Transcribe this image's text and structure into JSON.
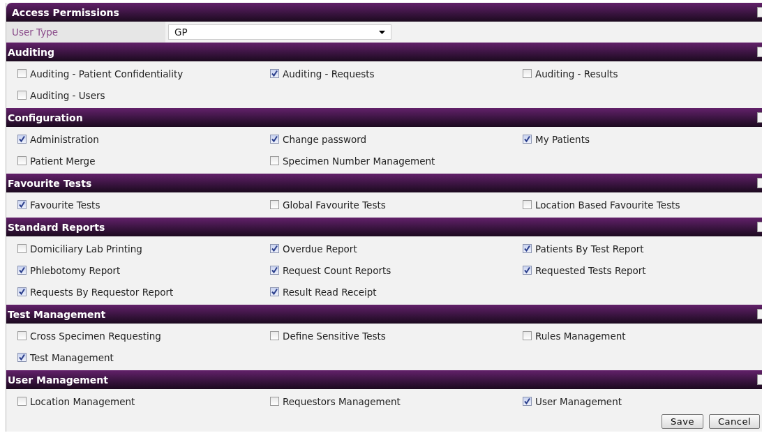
{
  "title": "Access Permissions",
  "title_checked": false,
  "user_type": {
    "label": "User Type",
    "value": "GP"
  },
  "sections": [
    {
      "title": "Auditing",
      "checked": false,
      "items": [
        {
          "label": "Auditing - Patient Confidentiality",
          "checked": false
        },
        {
          "label": "Auditing - Requests",
          "checked": true
        },
        {
          "label": "Auditing - Results",
          "checked": false
        },
        {
          "label": "Auditing - Users",
          "checked": false
        }
      ]
    },
    {
      "title": "Configuration",
      "checked": false,
      "items": [
        {
          "label": "Administration",
          "checked": true
        },
        {
          "label": "Change password",
          "checked": true
        },
        {
          "label": "My Patients",
          "checked": true
        },
        {
          "label": "Patient Merge",
          "checked": false
        },
        {
          "label": "Specimen Number Management",
          "checked": false
        }
      ]
    },
    {
      "title": "Favourite Tests",
      "checked": false,
      "items": [
        {
          "label": "Favourite Tests",
          "checked": true
        },
        {
          "label": "Global Favourite Tests",
          "checked": false
        },
        {
          "label": "Location Based Favourite Tests",
          "checked": false
        }
      ]
    },
    {
      "title": "Standard Reports",
      "checked": false,
      "items": [
        {
          "label": "Domiciliary Lab Printing",
          "checked": false
        },
        {
          "label": "Overdue Report",
          "checked": true
        },
        {
          "label": "Patients By Test Report",
          "checked": true
        },
        {
          "label": "Phlebotomy Report",
          "checked": true
        },
        {
          "label": "Request Count Reports",
          "checked": true
        },
        {
          "label": "Requested Tests Report",
          "checked": true
        },
        {
          "label": "Requests By Requestor Report",
          "checked": true
        },
        {
          "label": "Result Read Receipt",
          "checked": true
        }
      ]
    },
    {
      "title": "Test Management",
      "checked": false,
      "items": [
        {
          "label": "Cross Specimen Requesting",
          "checked": false
        },
        {
          "label": "Define Sensitive Tests",
          "checked": false
        },
        {
          "label": "Rules Management",
          "checked": false
        },
        {
          "label": "Test Management",
          "checked": true
        }
      ]
    },
    {
      "title": "User Management",
      "checked": false,
      "items": [
        {
          "label": "Location Management",
          "checked": false
        },
        {
          "label": "Requestors Management",
          "checked": false
        },
        {
          "label": "User Management",
          "checked": true
        }
      ]
    }
  ],
  "buttons": [
    "Save",
    "Cancel"
  ]
}
